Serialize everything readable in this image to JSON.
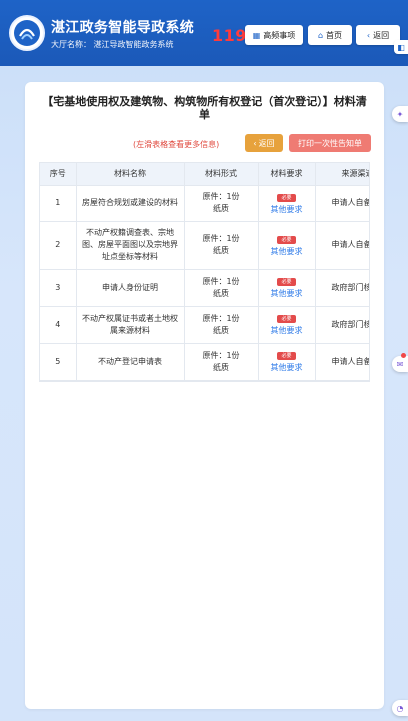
{
  "header": {
    "title": "湛江政务智能导政系统",
    "subtitle": "大厅名称：  湛江导政智能政务系统",
    "countdown": "119",
    "buttons": {
      "frequent": "高频事项",
      "home": "首页",
      "back": "返回"
    },
    "colors": {
      "bar": "#1e63c7",
      "countdown": "#ff3b3b"
    }
  },
  "page": {
    "title": "【宅基地使用权及建筑物、构筑物所有权登记（首次登记）】材料清单",
    "hint": "(左滑表格查看更多信息)",
    "return_label": "返回",
    "print_label": "打印一次性告知单"
  },
  "table": {
    "headers": [
      "序号",
      "材料名称",
      "材料形式",
      "材料要求",
      "来源渠道"
    ],
    "rows": [
      {
        "no": "1",
        "name": "房屋符合规划或建设的材料",
        "form": "原件：1份\n纸质",
        "badge": "必要",
        "link": "其他要求",
        "source": "申请人自备"
      },
      {
        "no": "2",
        "name": "不动产权籍调查表、宗地图、房屋平面图以及宗地界址点坐标等材料",
        "form": "原件：1份\n纸质",
        "badge": "必要",
        "link": "其他要求",
        "source": "申请人自备"
      },
      {
        "no": "3",
        "name": "申请人身份证明",
        "form": "原件：1份\n纸质",
        "badge": "必要",
        "link": "其他要求",
        "source": "政府部门核发"
      },
      {
        "no": "4",
        "name": "不动产权属证书或者土地权属来源材料",
        "form": "原件：1份\n纸质",
        "badge": "必要",
        "link": "其他要求",
        "source": "政府部门核发"
      },
      {
        "no": "5",
        "name": "不动产登记申请表",
        "form": "原件：1份\n纸质",
        "badge": "必要",
        "link": "其他要求",
        "source": "申请人自备"
      }
    ]
  },
  "icons": {
    "frequent": "grid-icon",
    "home": "home-icon",
    "back": "chevron-left-icon"
  }
}
